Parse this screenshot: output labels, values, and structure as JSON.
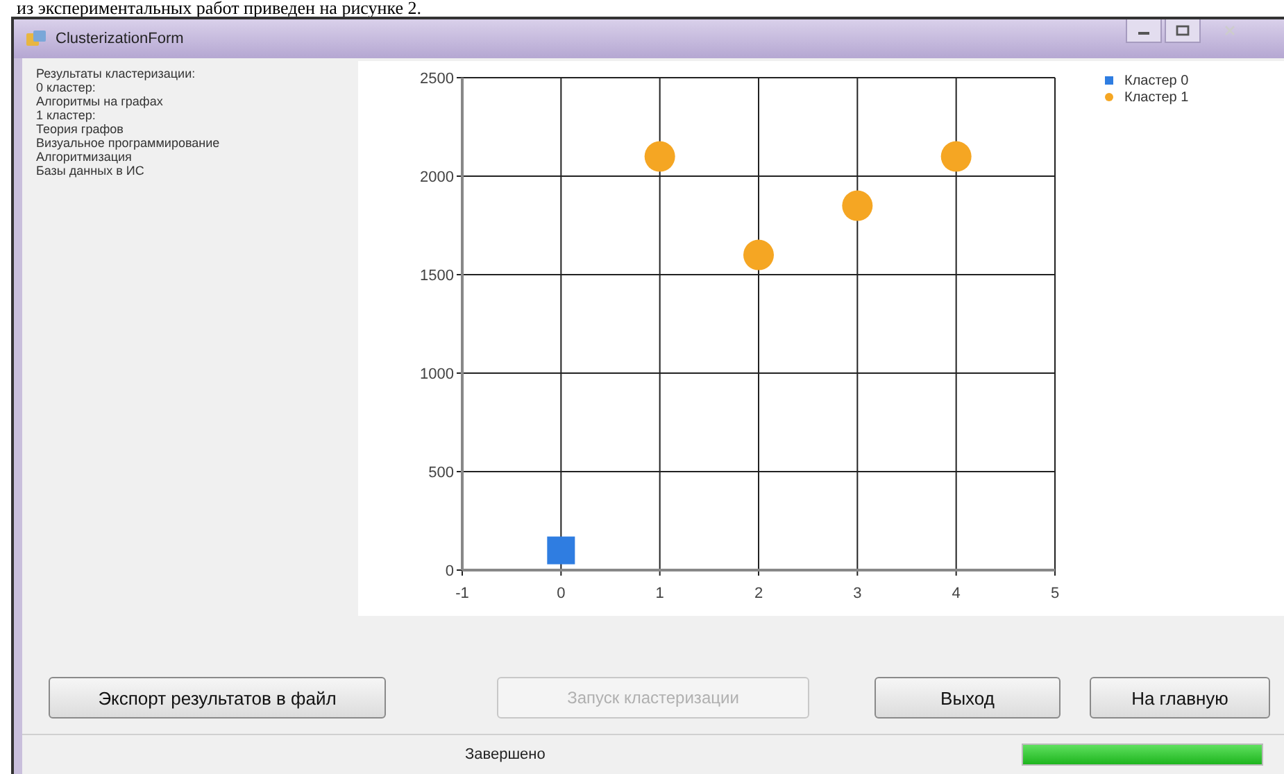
{
  "document_text": "из экспериментальных работ приведен на рисунке 2.",
  "window": {
    "title": "ClusterizationForm"
  },
  "results_lines": [
    "Результаты кластеризации:",
    "0 кластер:",
    "Алгоритмы на графах",
    "1 кластер:",
    "Теория графов",
    "Визуальное программирование",
    "Алгоритмизация",
    "Базы данных в ИС"
  ],
  "chart": {
    "chart_data": {
      "type": "scatter",
      "x": [
        0,
        1,
        2,
        3,
        4
      ],
      "series": [
        {
          "name": "Кластер 0",
          "color": "#2f7de1",
          "values": [
            100,
            null,
            null,
            null,
            null
          ]
        },
        {
          "name": "Кластер 1",
          "color": "#f5a623",
          "values": [
            null,
            2100,
            1600,
            1850,
            2100
          ]
        }
      ],
      "xlim": [
        -1,
        5
      ],
      "ylim": [
        0,
        2500
      ],
      "xticks": [
        -1,
        0,
        1,
        2,
        3,
        4,
        5
      ],
      "yticks": [
        0,
        500,
        1000,
        1500,
        2000,
        2500
      ],
      "grid": true
    }
  },
  "buttons": [
    {
      "label": "Экспорт результатов в файл",
      "disabled": false
    },
    {
      "label": "Запуск кластеризации",
      "disabled": true
    },
    {
      "label": "Выход",
      "disabled": false
    },
    {
      "label": "На главную",
      "disabled": false
    }
  ],
  "status_bar": {
    "text": "Завершено",
    "progress": {
      "level": 1
    }
  }
}
